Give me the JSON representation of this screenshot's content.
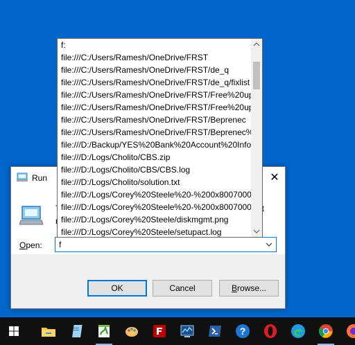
{
  "run_dialog": {
    "title": "Run",
    "close_glyph": "✕",
    "description_line1_start": "T",
    "description_line1_end": "et",
    "description_line2_start": "r",
    "open_label_underlined": "O",
    "open_label_rest": "pen:",
    "open_value": "f",
    "ok_label": "OK",
    "cancel_label": "Cancel",
    "browse_label_underlined": "B",
    "browse_label_rest": "rowse..."
  },
  "autocomplete": {
    "items": [
      "f:",
      "file:///C:/Users/Ramesh/OneDrive/FRST",
      "file:///C:/Users/Ramesh/OneDrive/FRST/de_q",
      "file:///C:/Users/Ramesh/OneDrive/FRST/de_q/fixlist",
      "file:///C:/Users/Ramesh/OneDrive/FRST/Free%20up",
      "file:///C:/Users/Ramesh/OneDrive/FRST/Free%20up",
      "file:///C:/Users/Ramesh/OneDrive/FRST/Вeprenec",
      "file:///C:/Users/Ramesh/OneDrive/FRST/Вepreneс%",
      "file:///D:/Backup/YES%20Bank%20Account%20Info.",
      "file:///D:/Logs/Cholito/CBS.zip",
      "file:///D:/Logs/Cholito/CBS/CBS.log",
      "file:///D:/Logs/Cholito/solution.txt",
      "file:///D:/Logs/Corey%20Steele%20-%200x80070003",
      "file:///D:/Logs/Corey%20Steele%20-%200x80070003",
      "file:///D:/Logs/Corey%20Steele/diskmgmt.png",
      "file:///D:/Logs/Corey%20Steele/setupact.log"
    ]
  },
  "taskbar": {
    "icons": [
      "windows-start-icon",
      "file-explorer-icon",
      "notepad-icon",
      "notepad-plus-plus-icon",
      "paint-icon",
      "filezilla-icon",
      "resource-monitor-icon",
      "powershell-icon",
      "help-icon",
      "opera-icon",
      "edge-icon",
      "chrome-icon",
      "firefox-icon"
    ]
  },
  "colors": {
    "desktop": "#0066cc",
    "taskbar": "#101010",
    "accent": "#0078d7"
  }
}
